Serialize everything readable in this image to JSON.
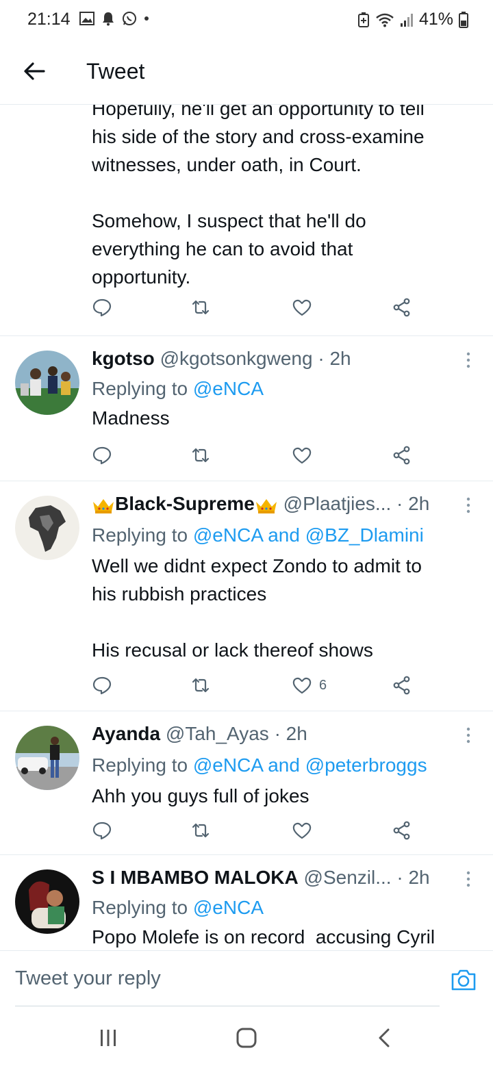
{
  "status_bar": {
    "time": "21:14",
    "battery": "41%"
  },
  "header": {
    "title": "Tweet"
  },
  "partial_tweet": {
    "text": "Hopefully, he'll get an opportunity to tell\nhis side of the story and cross-examine\nwitnesses, under oath, in Court.\n\nSomehow, I suspect that he'll do\neverything he can to avoid that\nopportunity."
  },
  "replies": [
    {
      "name": "kgotso",
      "handle": "@kgotsonkgweng",
      "time": "· 2h",
      "replying_prefix": "Replying to",
      "replying_to": "@eNCA",
      "text": "Madness",
      "likes": ""
    },
    {
      "name": "Black-Supreme",
      "handle": "@Plaatjies...",
      "time": "· 2h",
      "replying_prefix": "Replying to",
      "replying_to": "@eNCA and @BZ_Dlamini",
      "text": "Well we didnt expect Zondo to admit to\nhis rubbish practices\n\nHis recusal or lack thereof shows",
      "likes": "6"
    },
    {
      "name": "Ayanda",
      "handle": "@Tah_Ayas",
      "time": "· 2h",
      "replying_prefix": "Replying to",
      "replying_to": "@eNCA and @peterbroggs",
      "text": "Ahh you guys full of jokes",
      "likes": ""
    },
    {
      "name": "S I MBAMBO MALOKA",
      "handle": "@Senzil...",
      "time": " · 2h",
      "replying_prefix": "Replying to",
      "replying_to": "@eNCA",
      "text": "Popo Molefe is on record  accusing Cyril",
      "likes": ""
    }
  ],
  "composer": {
    "placeholder": "Tweet your reply"
  },
  "colors": {
    "link": "#1d9bf0",
    "muted": "#536471",
    "text": "#0f1419",
    "divider": "#e6ecf0"
  },
  "icons": [
    "back-arrow-icon",
    "reply-icon",
    "retweet-icon",
    "like-icon",
    "share-icon",
    "more-icon",
    "camera-icon"
  ]
}
